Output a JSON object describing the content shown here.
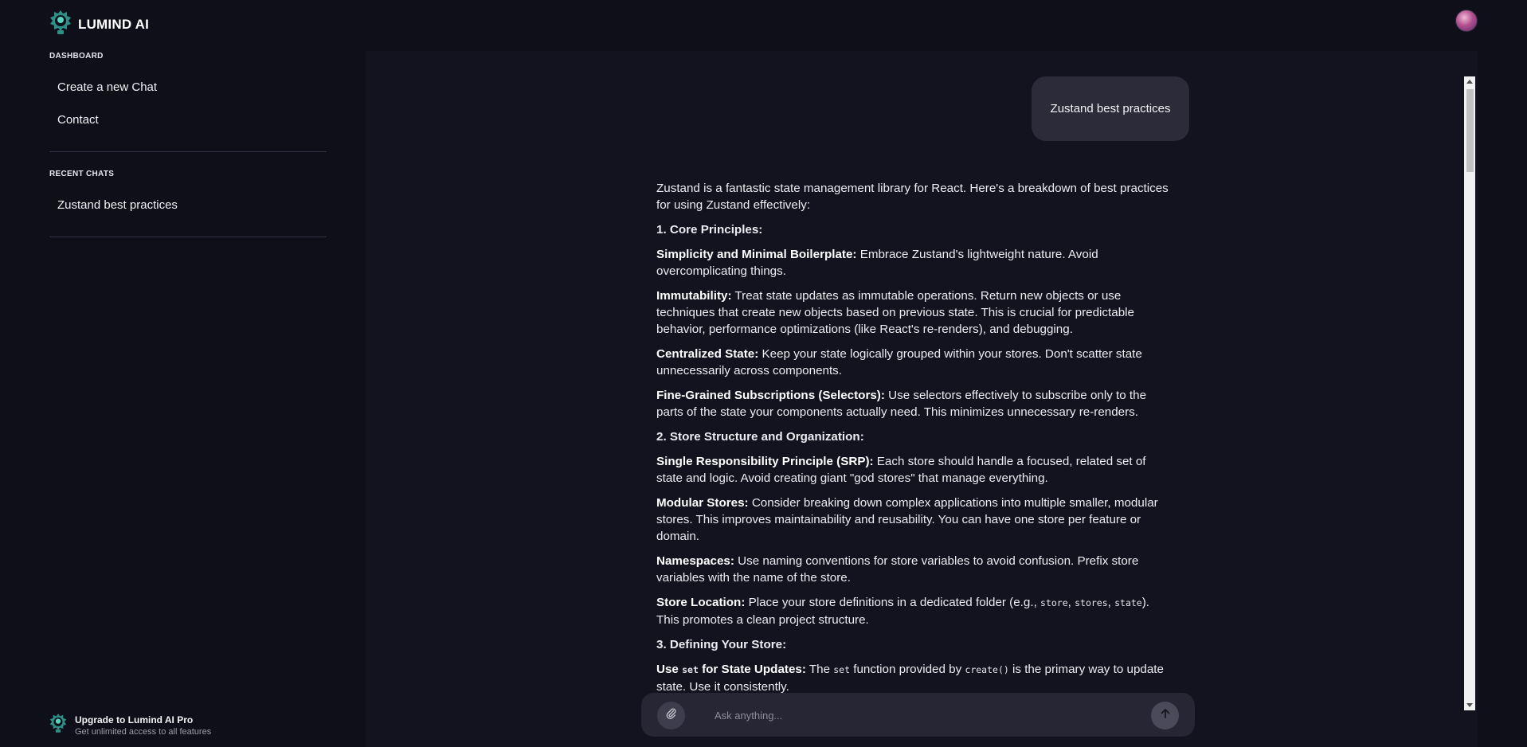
{
  "app": {
    "name": "LUMIND AI",
    "logo_icon": "lumind-logo-icon"
  },
  "sidebar": {
    "dashboard_label": "DASHBOARD",
    "items": [
      {
        "label": "Create a new Chat"
      },
      {
        "label": "Contact"
      }
    ],
    "recent_label": "RECENT CHATS",
    "recent": [
      {
        "label": "Zustand best practices"
      }
    ],
    "upgrade": {
      "title": "Upgrade to Lumind AI Pro",
      "subtitle": "Get unlimited access to all features"
    }
  },
  "chat": {
    "user_message": "Zustand best practices",
    "intro": "Zustand is a fantastic state management library for React. Here's a breakdown of best practices for using Zustand effectively:",
    "sections": [
      {
        "heading": "1. Core Principles:",
        "items": [
          {
            "bold": "Simplicity and Minimal Boilerplate:",
            "text": " Embrace Zustand's lightweight nature. Avoid overcomplicating things."
          },
          {
            "bold": "Immutability:",
            "text": " Treat state updates as immutable operations. Return new objects or use techniques that create new objects based on previous state. This is crucial for predictable behavior, performance optimizations (like React's re-renders), and debugging."
          },
          {
            "bold": "Centralized State:",
            "text": " Keep your state logically grouped within your stores. Don't scatter state unnecessarily across components."
          },
          {
            "bold": "Fine-Grained Subscriptions (Selectors):",
            "text": " Use selectors effectively to subscribe only to the parts of the state your components actually need. This minimizes unnecessary re-renders."
          }
        ]
      },
      {
        "heading": "2. Store Structure and Organization:",
        "items": [
          {
            "bold": "Single Responsibility Principle (SRP):",
            "text": " Each store should handle a focused, related set of state and logic. Avoid creating giant \"god stores\" that manage everything."
          },
          {
            "bold": "Modular Stores:",
            "text": " Consider breaking down complex applications into multiple smaller, modular stores. This improves maintainability and reusability. You can have one store per feature or domain."
          },
          {
            "bold": "Namespaces:",
            "text": " Use naming conventions for store variables to avoid confusion. Prefix store variables with the name of the store."
          }
        ]
      }
    ],
    "store_location": {
      "bold": "Store Location:",
      "text_before": " Place your store definitions in a dedicated folder (e.g., ",
      "code1": "store",
      "sep1": ", ",
      "code2": "stores",
      "sep2": ", ",
      "code3": "state",
      "text_after": "). This promotes a clean project structure."
    },
    "section3_heading": "3. Defining Your Store:",
    "use_set": {
      "bold_before": "Use ",
      "bold_code": "set",
      "bold_after": " for State Updates:",
      "text1": " The ",
      "code1": "set",
      "text2": " function provided by ",
      "code2": "create()",
      "text3": " is the primary way to update state. Use it consistently."
    }
  },
  "composer": {
    "placeholder": "Ask anything...",
    "value": "",
    "attach_icon": "paperclip-icon",
    "send_icon": "arrow-up-icon"
  }
}
